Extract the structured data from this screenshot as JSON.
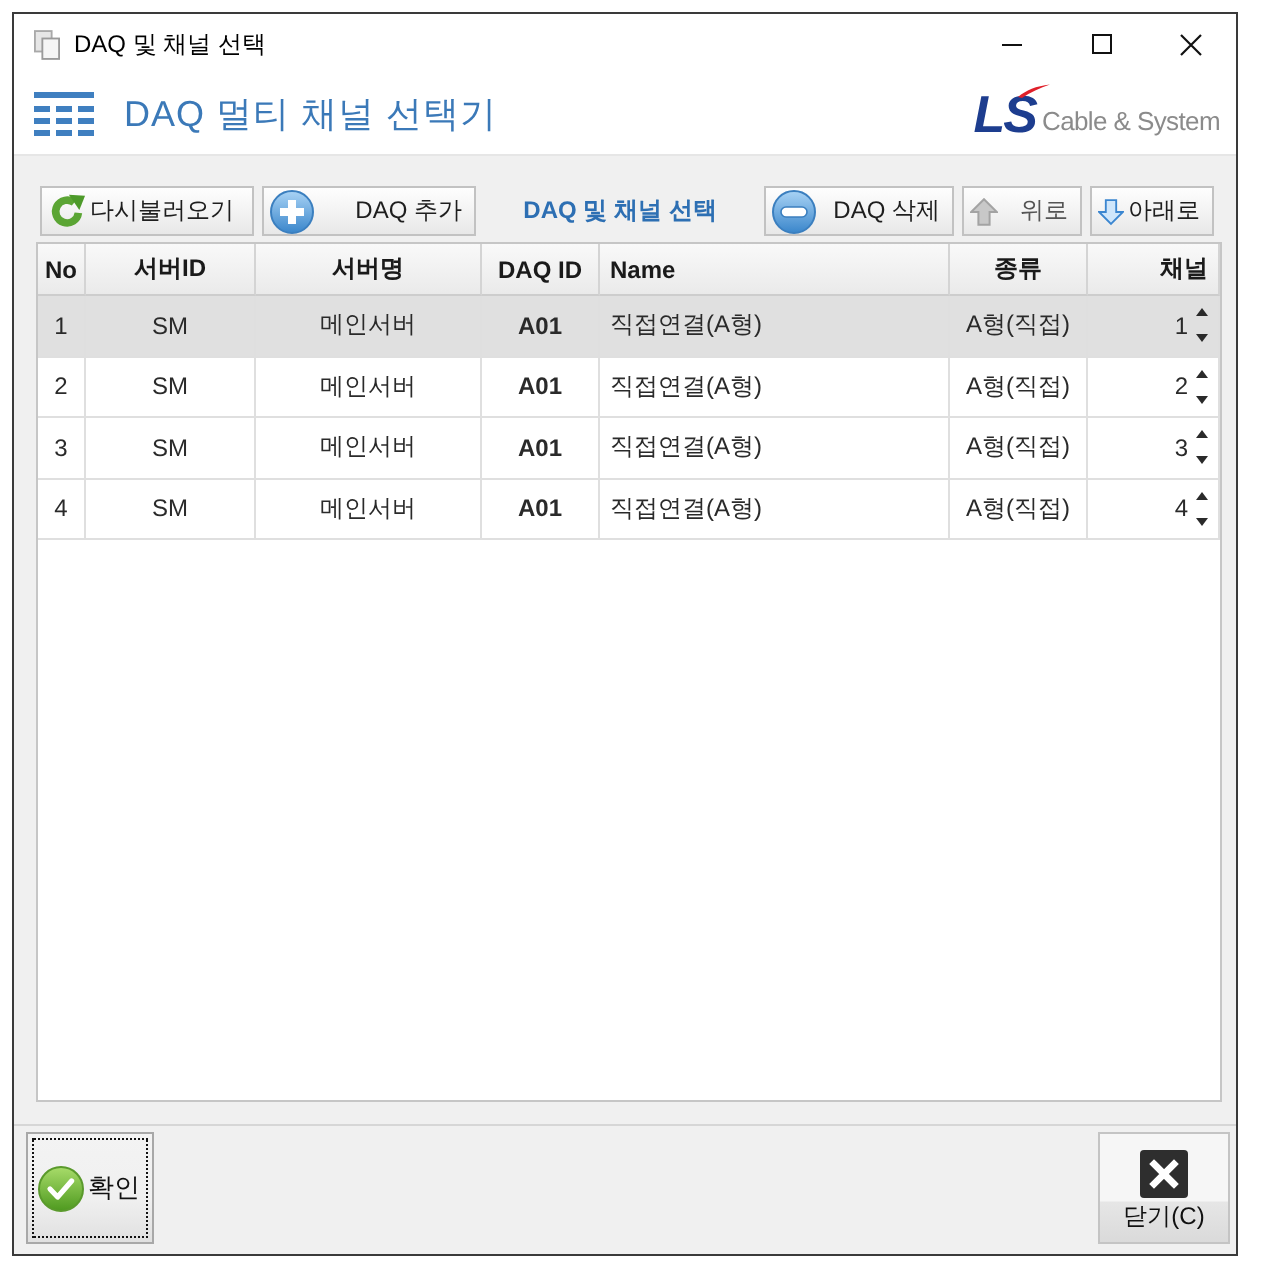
{
  "window": {
    "title": "DAQ 및 채널 선택"
  },
  "header": {
    "title": "DAQ 멀티 채널 선택기",
    "logo": {
      "mark": "LS",
      "text": "Cable & System"
    }
  },
  "toolbar": [
    {
      "kind": "reload",
      "label": "다시불러오기",
      "disabled": false
    },
    {
      "kind": "add",
      "label": "DAQ 추가",
      "disabled": false
    },
    {
      "kind": "caption",
      "label": "DAQ 및 채널 선택"
    },
    {
      "kind": "remove",
      "label": "DAQ 삭제",
      "disabled": false
    },
    {
      "kind": "up",
      "label": "위로",
      "disabled": true
    },
    {
      "kind": "down",
      "label": "아래로",
      "disabled": false
    }
  ],
  "table": {
    "columns": [
      "No",
      "서버ID",
      "서버명",
      "DAQ ID",
      "Name",
      "종류",
      "채널"
    ],
    "rows": [
      {
        "no": "1",
        "server_id": "SM",
        "server_name": "메인서버",
        "daq_id": "A01",
        "name": "직접연결(A형)",
        "type": "A형(직접)",
        "channel": "1",
        "selected": true
      },
      {
        "no": "2",
        "server_id": "SM",
        "server_name": "메인서버",
        "daq_id": "A01",
        "name": "직접연결(A형)",
        "type": "A형(직접)",
        "channel": "2",
        "selected": false
      },
      {
        "no": "3",
        "server_id": "SM",
        "server_name": "메인서버",
        "daq_id": "A01",
        "name": "직접연결(A형)",
        "type": "A형(직접)",
        "channel": "3",
        "selected": false
      },
      {
        "no": "4",
        "server_id": "SM",
        "server_name": "메인서버",
        "daq_id": "A01",
        "name": "직접연결(A형)",
        "type": "A형(직접)",
        "channel": "4",
        "selected": false
      }
    ]
  },
  "footer": [
    {
      "kind": "confirm",
      "label": "확인",
      "focused": true
    },
    {
      "kind": "close",
      "label": "닫기(C)",
      "focused": false
    }
  ]
}
